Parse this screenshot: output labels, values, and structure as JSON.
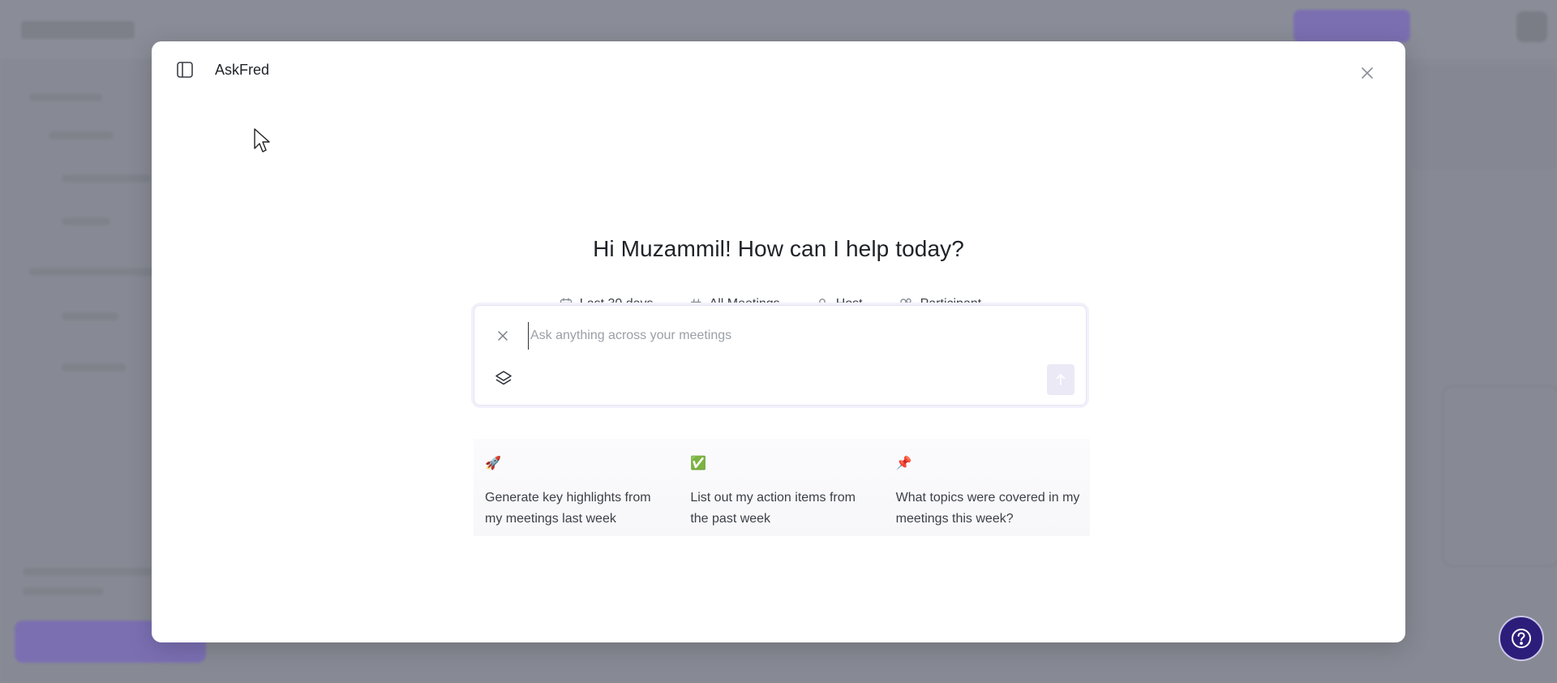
{
  "modal": {
    "title": "AskFred",
    "greeting": "Hi Muzammil! How can I help today?"
  },
  "filters": [
    {
      "label": "Last 30 days",
      "icon": "calendar-icon"
    },
    {
      "label": "All Meetings",
      "icon": "hash-icon"
    },
    {
      "label": "Host",
      "icon": "person-icon"
    },
    {
      "label": "Participant",
      "icon": "people-icon"
    }
  ],
  "composer": {
    "placeholder": "Ask anything across your meetings",
    "value": ""
  },
  "suggestions": [
    {
      "emoji": "🚀",
      "text": "Generate key highlights from my meetings last week"
    },
    {
      "emoji": "✅",
      "text": "List out my action items from the past week"
    },
    {
      "emoji": "📌",
      "text": "What topics were covered in my meetings this week?"
    }
  ],
  "colors": {
    "overlay": "#878a94",
    "brand": "#2d1d7a",
    "send_disabled": "#ebe9f5"
  }
}
